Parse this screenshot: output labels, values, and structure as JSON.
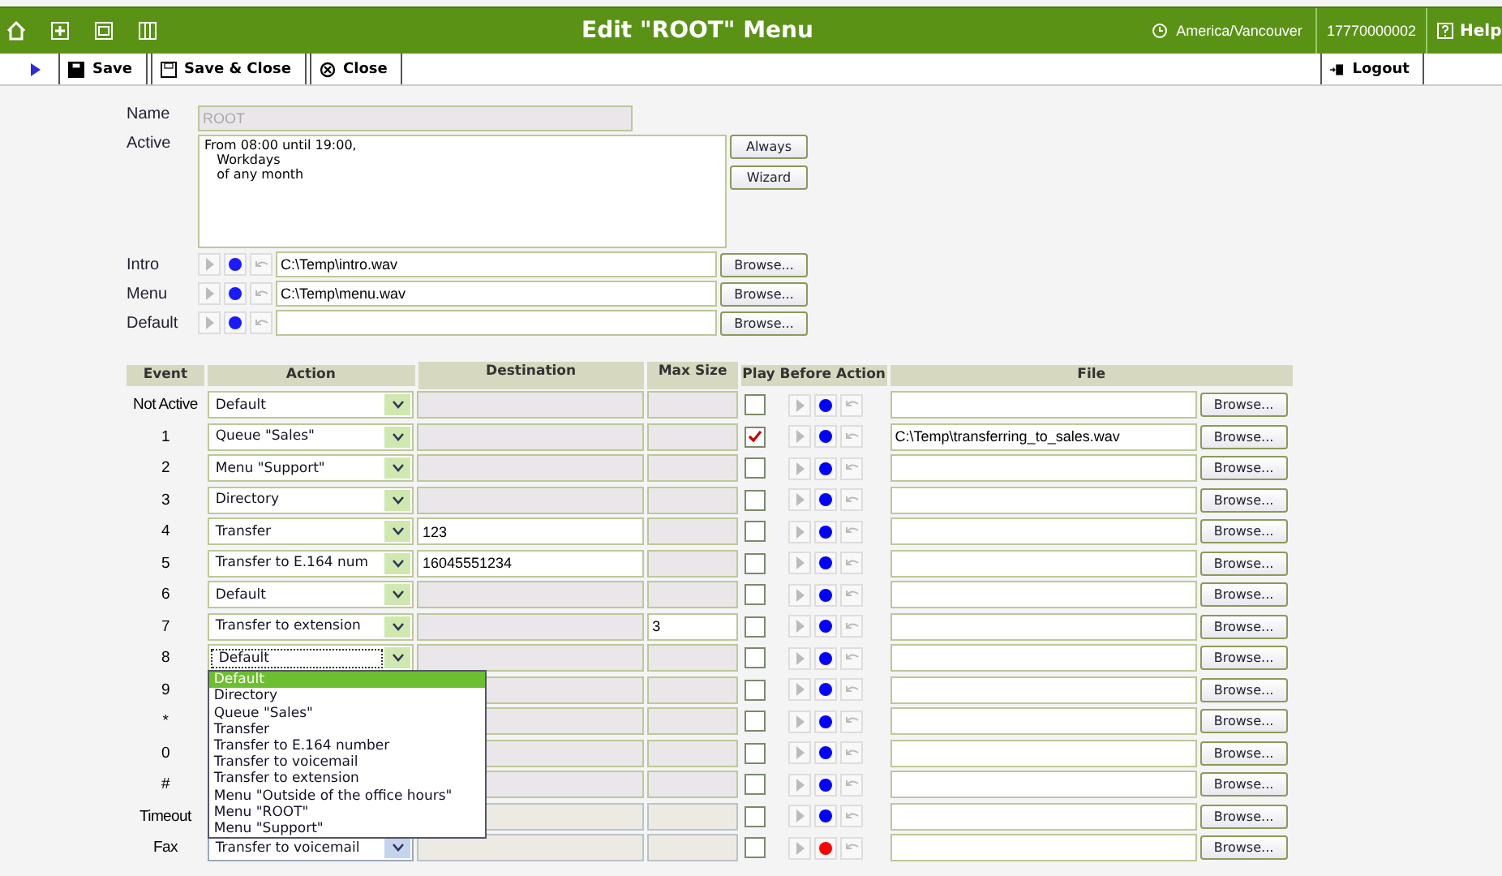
{
  "header": {
    "title": "Edit \"ROOT\" Menu",
    "timezone": "America/Vancouver",
    "account": "17770000002",
    "help": "Help"
  },
  "toolbar": {
    "buttons": [
      {
        "kind": "save",
        "label": "Save"
      },
      {
        "kind": "save_close",
        "label": "Save & Close"
      },
      {
        "kind": "close",
        "label": "Close"
      }
    ],
    "logout": "Logout"
  },
  "form": {
    "name_label": "Name",
    "name_value": "ROOT",
    "active_label": "Active",
    "active_text": "From 08:00 until 19:00,\n   Workdays\n   of any month",
    "active_buttons": [
      "Always",
      "Wizard"
    ],
    "prompts": [
      {
        "label": "Intro",
        "file": "C:\\Temp\\intro.wav",
        "browse": "Browse..."
      },
      {
        "label": "Menu",
        "file": "C:\\Temp\\menu.wav",
        "browse": "Browse..."
      },
      {
        "label": "Default",
        "browse": "Browse..."
      }
    ]
  },
  "table": {
    "columns": [
      "Event",
      "Action",
      "Destination",
      "Max Size",
      "Play Before Action",
      "File"
    ],
    "rows": [
      {
        "event": "Not Active",
        "action": "Default",
        "destination_enabled": false,
        "max_size_enabled": false,
        "checked": false,
        "color": "#0000ff",
        "browse": "Browse..."
      },
      {
        "event": "1",
        "action": "Queue \"Sales\"",
        "destination_enabled": false,
        "max_size_enabled": false,
        "checked": true,
        "color": "#0000ff",
        "file": "C:\\Temp\\transferring_to_sales.wav",
        "browse": "Browse..."
      },
      {
        "event": "2",
        "action": "Menu \"Support\"",
        "destination_enabled": false,
        "max_size_enabled": false,
        "checked": false,
        "color": "#0000ff",
        "browse": "Browse..."
      },
      {
        "event": "3",
        "action": "Directory",
        "destination_enabled": false,
        "max_size_enabled": false,
        "checked": false,
        "color": "#0000ff",
        "browse": "Browse..."
      },
      {
        "event": "4",
        "action": "Transfer",
        "destination": "123",
        "destination_enabled": true,
        "max_size_enabled": false,
        "checked": false,
        "color": "#0000ff",
        "browse": "Browse..."
      },
      {
        "event": "5",
        "action": "Transfer to E.164 num",
        "destination": "16045551234",
        "destination_enabled": true,
        "max_size_enabled": false,
        "checked": false,
        "color": "#0000ff",
        "browse": "Browse..."
      },
      {
        "event": "6",
        "action": "Default",
        "destination_enabled": false,
        "max_size_enabled": false,
        "checked": false,
        "color": "#0000ff",
        "browse": "Browse..."
      },
      {
        "event": "7",
        "action": "Transfer to extension",
        "destination_enabled": false,
        "max_size": "3",
        "max_size_enabled": true,
        "checked": false,
        "color": "#0000ff",
        "browse": "Browse..."
      },
      {
        "event": "8",
        "action": "Default",
        "expanded": true,
        "options": [
          {
            "label": "Default",
            "selected": true
          },
          {
            "label": "Directory",
            "selected": false
          },
          {
            "label": "Queue \"Sales\"",
            "selected": false
          },
          {
            "label": "Transfer",
            "selected": false
          },
          {
            "label": "Transfer to E.164 number",
            "selected": false
          },
          {
            "label": "Transfer to voicemail",
            "selected": false
          },
          {
            "label": "Transfer to extension",
            "selected": false
          },
          {
            "label": "Menu \"Outside of the office hours\"",
            "selected": false
          },
          {
            "label": "Menu \"ROOT\"",
            "selected": false
          },
          {
            "label": "Menu \"Support\"",
            "selected": false
          }
        ],
        "destination_enabled": false,
        "max_size_enabled": false,
        "checked": false,
        "color": "#0000ff",
        "browse": "Browse..."
      },
      {
        "event": "9",
        "destination_enabled": false,
        "max_size_enabled": false,
        "checked": false,
        "color": "#0000ff",
        "browse": "Browse..."
      },
      {
        "event": "*",
        "destination_enabled": false,
        "max_size_enabled": false,
        "checked": false,
        "color": "#0000ff",
        "browse": "Browse..."
      },
      {
        "event": "0",
        "destination_enabled": false,
        "max_size_enabled": false,
        "checked": false,
        "color": "#0000ff",
        "browse": "Browse..."
      },
      {
        "event": "#",
        "destination_enabled": false,
        "max_size_enabled": false,
        "checked": false,
        "color": "#0000ff",
        "browse": "Browse..."
      },
      {
        "event": "Timeout",
        "destination_enabled": false,
        "max_size_enabled": false,
        "checked": false,
        "color": "#0000ff",
        "browse": "Browse..."
      },
      {
        "event": "Fax",
        "action": "Transfer to voicemail",
        "destination_enabled": false,
        "max_size_enabled": false,
        "checked": false,
        "color": "#ff0000",
        "browse": "Browse..."
      }
    ]
  }
}
